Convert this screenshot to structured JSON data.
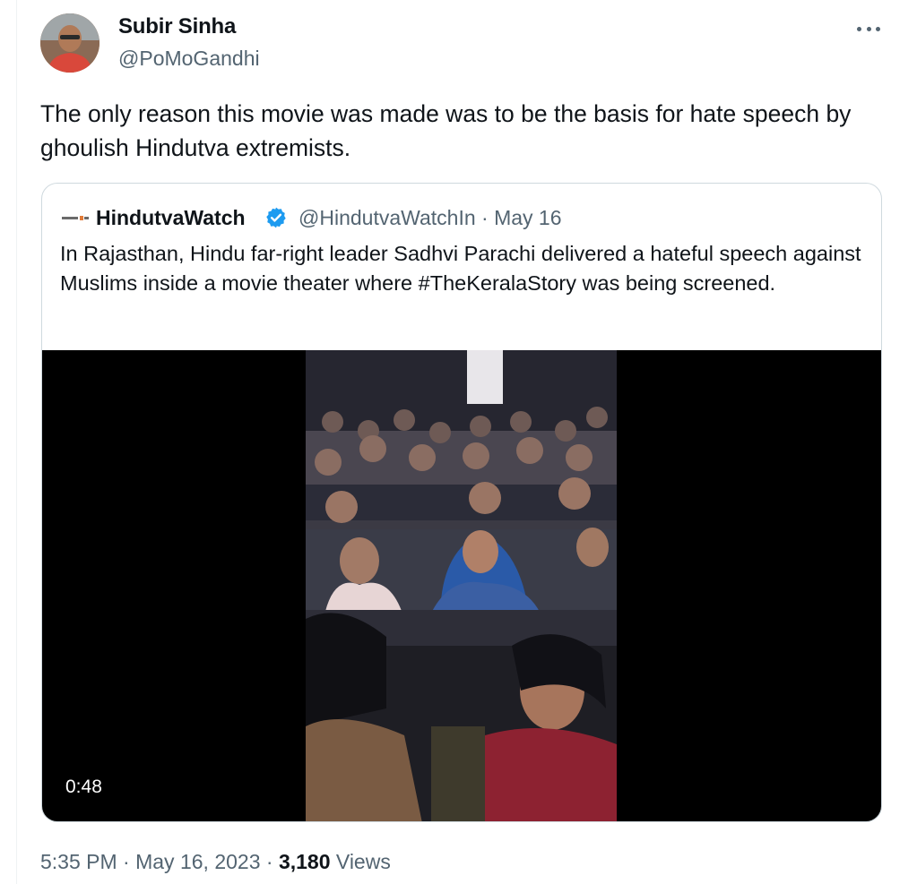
{
  "tweet": {
    "author_name": "Subir Sinha",
    "author_handle": "@PoMoGandhi",
    "text": "The only reason this movie was made was to be the basis for hate speech by ghoulish Hindutva extremists.",
    "time": "5:35 PM",
    "separator": "·",
    "date": "May 16, 2023",
    "views_count": "3,180",
    "views_label": "Views"
  },
  "quote": {
    "author_name": "HindutvaWatch",
    "handle_date": "@HindutvaWatchIn · May 16",
    "verified_icon": "verified-badge-icon",
    "text": "In Rajasthan, Hindu far-right leader Sadhvi Parachi delivered a hateful speech against Muslims inside a movie theater where #TheKeralaStory was being screened.",
    "video": {
      "duration": "0:48"
    }
  },
  "icons": {
    "more": "more-options-icon",
    "logo": "hindutvawatch-logo-icon"
  },
  "colors": {
    "text_primary": "#0f1419",
    "text_secondary": "#536471",
    "verified_blue": "#1d9bf0",
    "border": "#cfd9de"
  }
}
